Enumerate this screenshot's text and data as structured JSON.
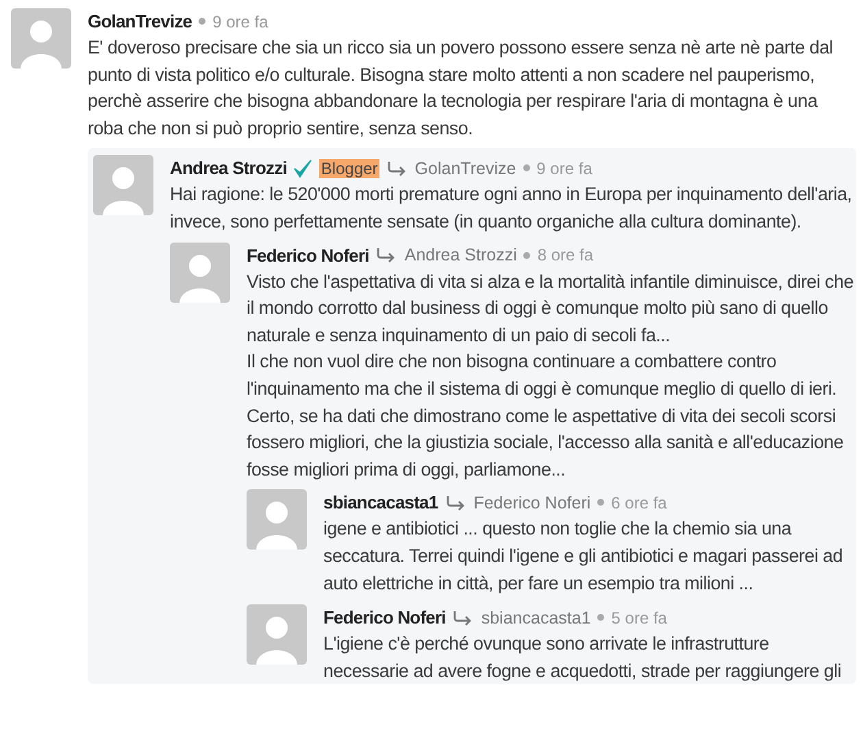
{
  "comments": [
    {
      "author": "GolanTrevize",
      "time": "9 ore fa",
      "body": [
        "E' doveroso precisare che sia un ricco sia un povero possono essere senza nè arte nè parte dal punto di vista politico e/o culturale. Bisogna stare molto attenti a non scadere nel pauperismo, perchè asserire che bisogna abbandonare la tecnologia per respirare l'aria di montagna è una roba che non si può proprio sentire, senza senso."
      ],
      "children": [
        {
          "author": "Andrea Strozzi",
          "verified": true,
          "badge": "Blogger",
          "reply_to": "GolanTrevize",
          "time": "9 ore fa",
          "body": [
            "Hai ragione: le 520'000 morti premature ogni anno in Europa per inquinamento dell'aria, invece, sono perfettamente sensate (in quanto organiche alla cultura dominante)."
          ],
          "children": [
            {
              "author": "Federico Noferi",
              "reply_to": "Andrea Strozzi",
              "time": "8 ore fa",
              "body": [
                "Visto che l'aspettativa di vita si alza e la mortalità infantile diminuisce, direi che il mondo corrotto dal business di oggi è comunque molto più sano di quello naturale e senza inquinamento di un paio di secoli fa...",
                "Il che non vuol dire che non bisogna continuare a combattere contro l'inquinamento ma che il sistema di oggi è comunque meglio di quello di ieri.",
                "Certo, se ha dati che dimostrano come le aspettative di vita dei secoli scorsi fossero migliori, che la giustizia sociale, l'accesso alla sanità e all'educazione fosse migliori prima di oggi, parliamone..."
              ],
              "children": [
                {
                  "author": "sbiancacasta1",
                  "reply_to": "Federico Noferi",
                  "time": "6 ore fa",
                  "body": [
                    "igene e antibiotici ... questo non toglie che la chemio sia una seccatura. Terrei quindi l'igene e gli antibiotici e magari passerei ad auto elettriche in città, per fare un esempio tra milioni ..."
                  ]
                },
                {
                  "author": "Federico Noferi",
                  "reply_to": "sbiancacasta1",
                  "time": "5 ore fa",
                  "body": [
                    "L'igiene c'è perché ovunque sono arrivate le infrastrutture necessarie ad avere fogne e acquedotti, strade per raggiungere gli"
                  ]
                }
              ]
            }
          ]
        }
      ]
    }
  ]
}
